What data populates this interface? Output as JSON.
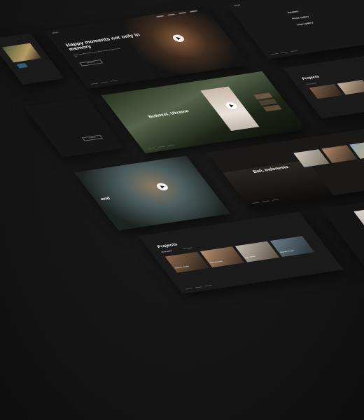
{
  "cards": {
    "hero_memory": {
      "title": "Happy moments not only in memory",
      "subtitle": "Really beautiful moments that will be stored throughout your life",
      "button_label": "Get Inspired",
      "nav_logo": "LOGO"
    },
    "bukovel": {
      "title": "Bukovel, Ukraine"
    },
    "bali": {
      "title": "Bali, Indonesia"
    },
    "menu": {
      "items": [
        "Reviews",
        "Photo gallery",
        "Video gallery"
      ]
    },
    "projects_small": {
      "title": "Projects",
      "tab": "Photo gallery"
    },
    "projects_big": {
      "title": "Projects",
      "tab_active": "Photo gallery",
      "tab_other": "Video gallery",
      "thumbs": [
        "Bukovel, Ukraine",
        "Bali, Indonesia",
        "Bali, Ukraine",
        "Bukovel, Ukraine"
      ]
    },
    "friend": {
      "title_fragment": "end"
    },
    "contact": {
      "button_label": "Contact us"
    }
  },
  "colors": {
    "background": "#151515",
    "card": "#1d1d1d",
    "accent_text": "#ffffff"
  }
}
